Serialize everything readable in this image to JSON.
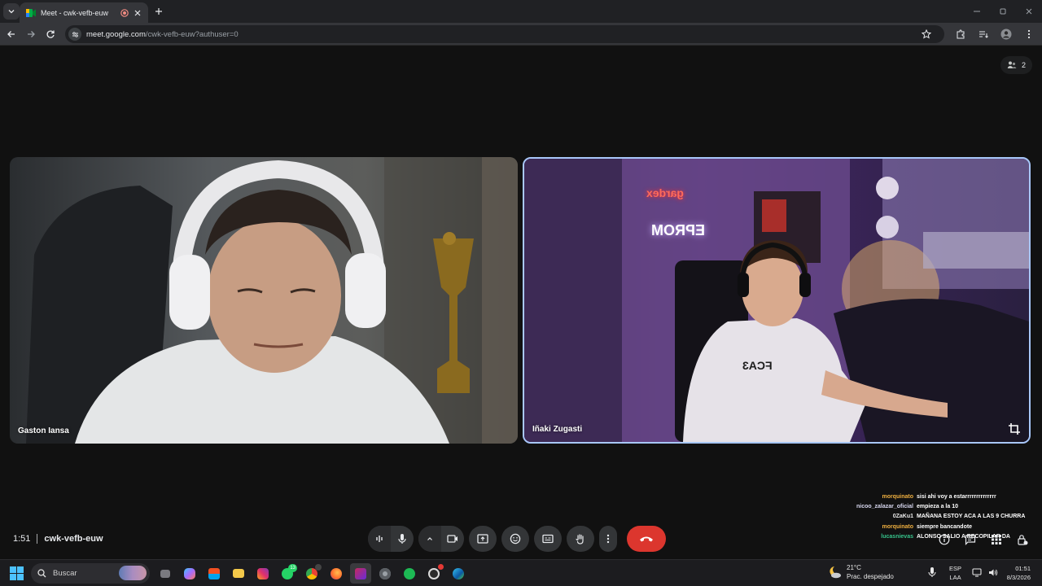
{
  "browser": {
    "tab_title": "Meet - cwk-vefb-euw",
    "url_host": "meet.google.com",
    "url_path": "/cwk-vefb-euw?authuser=0"
  },
  "meet": {
    "participant_count": "2",
    "time": "1:51",
    "meeting_code": "cwk-vefb-euw",
    "participants": [
      {
        "name": "Gaston Iansa"
      },
      {
        "name": "Iñaki Zugasti"
      }
    ],
    "scene_text": {
      "brand_sign": "gardex",
      "neon_sign": "EPROM",
      "shirt_text": "FCA3"
    }
  },
  "chat": [
    {
      "user": "",
      "message": ""
    },
    {
      "user": "morquinato",
      "message": "sisi ahi voy a estarrrrrrrrrrrrrr"
    },
    {
      "user": "nicoo_zalazar_oficial",
      "message": "empieza a la 10"
    },
    {
      "user": "0ZaKu1",
      "message": "MAÑANA ESTOY ACA A LAS 9 CHURRA"
    },
    {
      "user": "morquinato",
      "message": "siempre bancandote"
    },
    {
      "user": "lucasnievas",
      "message": "ALONSO SALIO A RECOPILAR DA"
    }
  ],
  "taskbar": {
    "search_placeholder": "Buscar",
    "whatsapp_badge": "13",
    "weather_temp": "21°C",
    "weather_desc": "Prac. despejado",
    "lang_1": "ESP",
    "lang_2": "LAA",
    "time": "01:51",
    "date": "8/3/2026"
  },
  "colors": {
    "accent_border": "#a8c7fa",
    "end_call": "#dc362e",
    "control_bg": "#333537",
    "chat_user_gold": "#f0b040",
    "chat_user_green": "#36c28a"
  }
}
